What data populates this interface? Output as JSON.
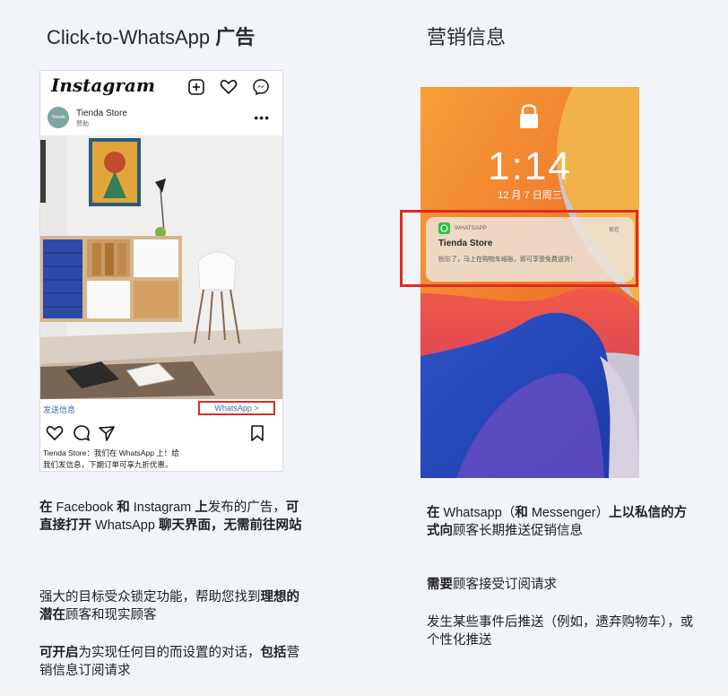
{
  "left_column": {
    "title_en": "Click-to-WhatsApp",
    "title_cn": "广告",
    "instagram": {
      "logo": "Instagram",
      "store_name": "Tienda Store",
      "sponsored": "赞助",
      "avatar_text": "Tienda Store",
      "more": "•••",
      "cta_left": "发送信息",
      "cta_right": "WhatsApp >",
      "caption_line1": "Tienda Store：我们在 WhatsApp 上！给",
      "caption_line2": "我们发信息，下期订单可享九折优惠。"
    },
    "paragraphs": {
      "p1_bold1": "在",
      "p1_normal1": " Facebook ",
      "p1_bold2": "和",
      "p1_normal2": " Instagram ",
      "p1_bold3": "上",
      "p1_normal3": "发布的广告，",
      "p1_bold4": "可直接打开",
      "p1_normal4": " WhatsApp ",
      "p1_bold5": "聊天界面，无需前往网站",
      "p2_normal1": "强大的目标受众锁定功能，帮助您找到",
      "p2_bold1": "理想的潜在",
      "p2_normal2": "顾客和现实顾客",
      "p3_bold1": "可开启",
      "p3_normal1": "为实现任何目的而设置的对话，",
      "p3_bold2": "包括",
      "p3_normal2": "营销信息订阅请求"
    }
  },
  "right_column": {
    "title": "营销信息",
    "lockscreen": {
      "time": "1:14",
      "date": "12 月 7 日周三",
      "notification": {
        "app": "WHATSAPP",
        "time": "现在",
        "title": "Tienda Store",
        "body": "别忘了，马上在购物车结账，即可享受免费送货！"
      }
    },
    "paragraphs": {
      "p1_bold1": "在",
      "p1_normal1": " Whatsapp（",
      "p1_bold2": "和",
      "p1_normal2": " Messenger）",
      "p1_bold3": "上以私信的方式向",
      "p1_normal3": "顾客长期推送促销信息",
      "p2_bold1": "需要",
      "p2_normal1": "顾客接受订阅请求",
      "p3_normal1": "发生某些事件后推送（例如，遗弃购物车），或个性化推送"
    }
  },
  "colors": {
    "highlight_red": "#e02b1f",
    "link_blue": "#3d6bb0",
    "background": "#f1f4f9"
  }
}
